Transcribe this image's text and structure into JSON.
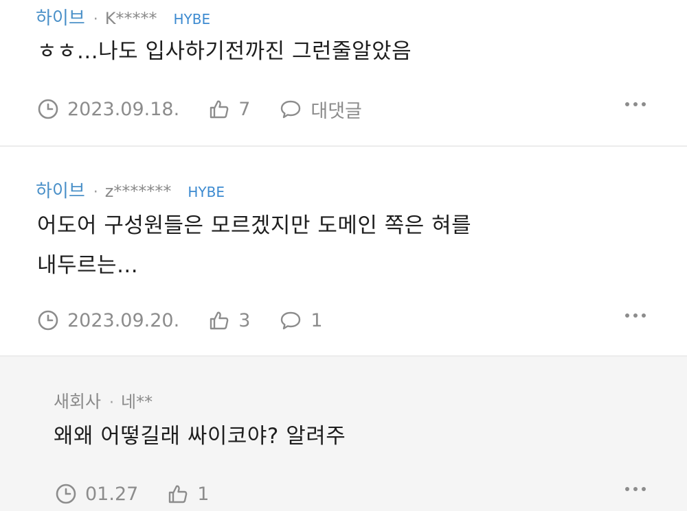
{
  "comments": [
    {
      "company": "하이브",
      "separator": "·",
      "author": "K*****",
      "tag": "HYBE",
      "lines": [
        "ㅎㅎ...나도 입사하기전까진 그런줄알았음"
      ],
      "date": "2023.09.18.",
      "likes": "7",
      "reply_label": "대댓글"
    },
    {
      "company": "하이브",
      "separator": "·",
      "author": "z*******",
      "tag": "HYBE",
      "lines": [
        "어도어 구성원들은 모르겠지만 도메인 쪽은 혀를",
        "내두르는..."
      ],
      "date": "2023.09.20.",
      "likes": "3",
      "reply_label": "1"
    }
  ],
  "reply": {
    "company": "새회사",
    "separator": "·",
    "author": "네**",
    "lines": [
      "왜왜 어떻길래 싸이코야? 알려주"
    ],
    "date": "01.27",
    "likes": "1"
  },
  "icons": {
    "clock": "clock-icon",
    "thumb": "thumbs-up-icon",
    "bubble": "speech-bubble-icon",
    "more": "more-dots-icon"
  },
  "colors": {
    "company": "#4a90c8",
    "tag": "#3c8ad0",
    "meta_gray": "#8c8c8c",
    "reply_bg": "#f5f5f5",
    "divider": "#ececec"
  }
}
